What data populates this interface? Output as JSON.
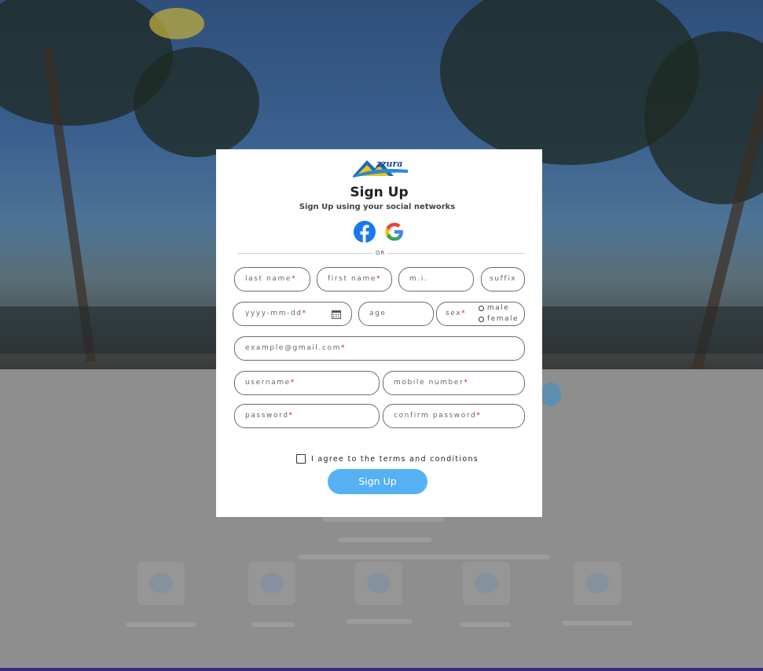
{
  "modal": {
    "title": "Sign Up",
    "subtitle": "Sign Up using your social networks",
    "or_text": "OR",
    "fields": {
      "last_name": "last name",
      "first_name": "first name",
      "middle_initial": "m.i.",
      "suffix": "suffix",
      "birthdate": "yyyy-mm-dd",
      "age": "age",
      "sex": "sex",
      "email": "example@gmail.com",
      "username": "username",
      "mobile_number": "mobile number",
      "password": "password",
      "confirm_password": "confirm password"
    },
    "required_marker": "*",
    "sex_options": [
      "male",
      "female"
    ],
    "agree_text": "I agree to the terms and conditions",
    "signup_button": "Sign Up",
    "social": {
      "facebook": "facebook-icon",
      "google": "google-icon"
    }
  },
  "colors": {
    "accent": "#55b1f4",
    "required": "#d02020",
    "bottom_bar": "#3b2a80"
  }
}
